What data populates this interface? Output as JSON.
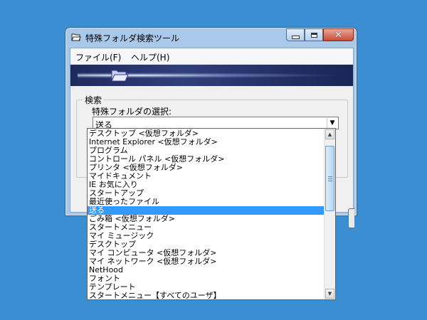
{
  "window": {
    "title": "特殊フォルダ検索ツール",
    "close_glyph": "✕"
  },
  "menu": {
    "file": "ファイル(F)",
    "help": "ヘルプ(H)"
  },
  "search": {
    "group_label": "検索",
    "select_label": "特殊フォルダの選択:",
    "selected_value": "送る",
    "dropdown_arrow": "▼"
  },
  "dropdown": {
    "items": [
      "デスクトップ <仮想フォルダ>",
      "Internet Explorer <仮想フォルダ>",
      "プログラム",
      "コントロール パネル <仮想フォルダ>",
      "プリンタ <仮想フォルダ>",
      "マイドキュメント",
      "IE お気に入り",
      "スタートアップ",
      "最近使ったファイル",
      "送る",
      "ごみ箱 <仮想フォルダ>",
      "スタートメニュー",
      "マイ ミュージック",
      "デスクトップ",
      "マイ コンピュータ <仮想フォルダ>",
      "マイ ネットワーク <仮想フォルダ>",
      "NetHood",
      "フォント",
      "テンプレート",
      "スタートメニュー【すべてのユーザ】"
    ],
    "selected_index": 9,
    "scroll_up": "▲",
    "scroll_down": "▼"
  }
}
